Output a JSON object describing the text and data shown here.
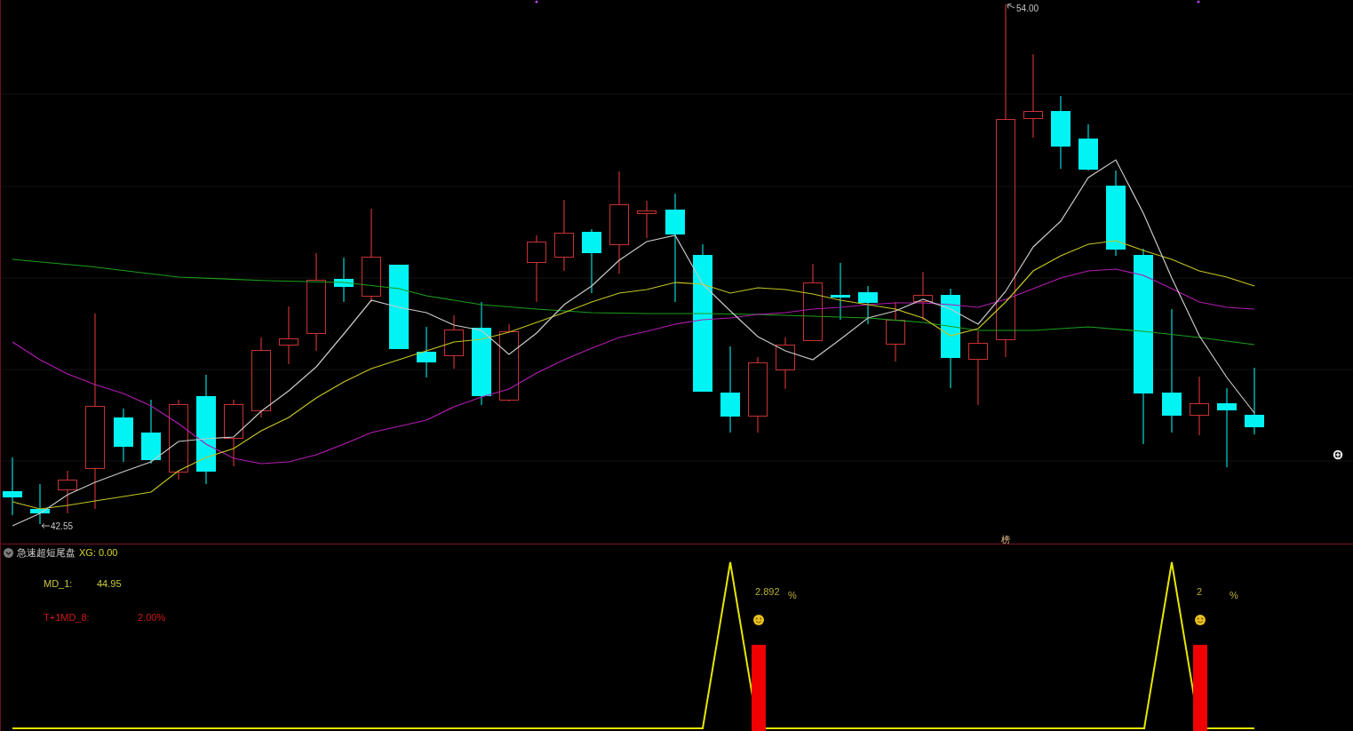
{
  "main_chart": {
    "high_label": "54.00",
    "low_label": "42.55",
    "marker_label": "榜"
  },
  "indicator_panel": {
    "title": "急速超短尾盘",
    "xg_label": "XG: 0.00",
    "readings": [
      {
        "label": "MD_1:",
        "value": "44.95",
        "color": "#c8c83c"
      },
      {
        "label": "T+1MD_8:",
        "value": "2.00%",
        "color": "#d01818"
      }
    ],
    "signals": [
      {
        "value": "2.892",
        "unit": "%"
      },
      {
        "value": "2",
        "unit": "%"
      }
    ]
  }
}
